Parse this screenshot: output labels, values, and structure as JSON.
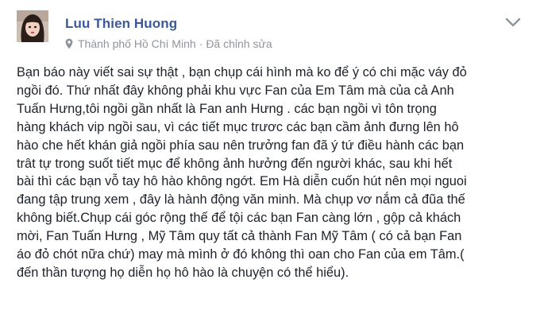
{
  "post": {
    "author_name": "Luu Thien Huong",
    "location": "Thành phố Hồ Chí Minh",
    "separator": "·",
    "edited_label": "Đã chỉnh sửa",
    "icons": {
      "avatar": "profile-photo",
      "location": "map-pin-icon",
      "menu": "chevron-down-icon"
    },
    "colors": {
      "author_link": "#3b5998",
      "meta_text": "#90949c",
      "body_text": "#1d2129"
    },
    "body_lines": [
      "Bạn báo này viết sai sự thật , bạn chụp cái hình mà ko để ý có chi mặc váy đỏ",
      "ngồi đó. Thứ nhất đây không phải khu vực Fan của Em Tâm mà của cả Anh",
      "Tuấn Hưng,tôi ngồi gần nhất là Fan anh Hưng . các bạn ngồi vì tôn trọng",
      "hàng khách vip ngồi sau, vì các tiết mục trươc các bạn cầm ảnh đưng lên hô",
      "hào che hết khán giả ngồi phía sau nên trưởng fan đã ý tứ điều hành các bạn",
      "trât tự trong suốt tiết mục để không ảnh hưởng đến người khác, sau khi hết",
      "bài thì các bạn vỗ tay hô hào không ngớt. Em Hà diễn cuốn hút nên mọi nguoi",
      "đang tập trung xem , đây là hành động văn minh. Mà chụp vơ nắm cả đũa thế",
      "không biết.Chụp cái góc rộng thế để tội các bạn Fan càng lớn , gộp cả khách",
      "mời, Fan Tuấn Hưng , Mỹ Tâm quy tất cả thành Fan Mỹ Tâm ( có cả bạn Fan",
      "áo đỏ chót nữa chứ) may mà mình ở đó không thì oan cho Fan của em Tâm.(",
      "đến thần tượng họ diễn họ hô hào là chuyện có thể hiểu)."
    ]
  }
}
